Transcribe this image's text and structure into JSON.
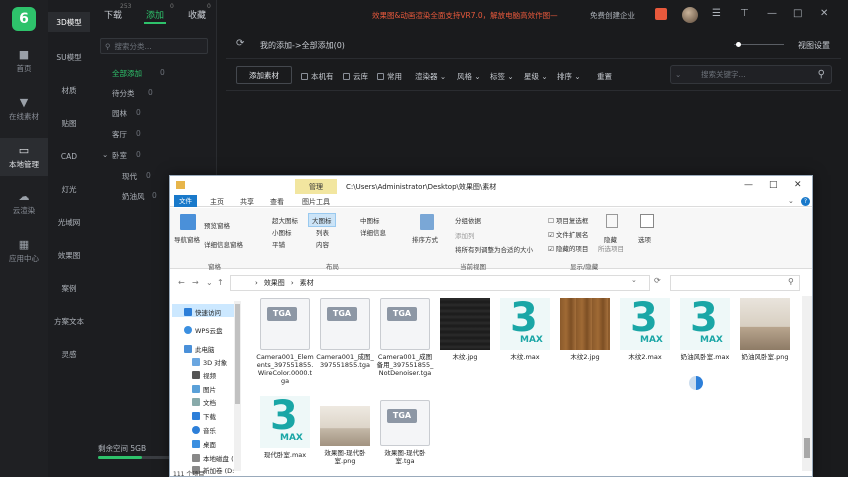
{
  "app": {
    "logo_glyph": "6",
    "rail": [
      {
        "icon": "cube-icon",
        "label": "首页"
      },
      {
        "icon": "download-icon",
        "label": "在线素材"
      },
      {
        "icon": "monitor-icon",
        "label": "本地管理",
        "active": true
      },
      {
        "icon": "cloud-icon",
        "label": "云渲染"
      },
      {
        "icon": "grid-icon",
        "label": "应用中心"
      }
    ],
    "categories": [
      "3D模型",
      "SU模型",
      "材质",
      "贴图",
      "CAD",
      "灯光",
      "光域网",
      "效果图",
      "案例",
      "方案文本",
      "灵感"
    ]
  },
  "tree": {
    "tabs": [
      {
        "label": "下载",
        "count": "253"
      },
      {
        "label": "添加",
        "count": "0"
      },
      {
        "label": "收藏",
        "count": "0"
      }
    ],
    "search_placeholder": "搜索分类...",
    "items": [
      {
        "label": "全部添加",
        "count": "0"
      },
      {
        "label": "待分类",
        "count": "0"
      },
      {
        "label": "园林",
        "count": "0"
      },
      {
        "label": "客厅",
        "count": "0"
      },
      {
        "label": "卧室",
        "count": "0"
      },
      {
        "label": "现代",
        "count": "0"
      },
      {
        "label": "奶油风",
        "count": "0"
      }
    ],
    "space_label": "剩余空间 5GB"
  },
  "header": {
    "banner": "效果图&动画渲染全面支持VR7.0，解放电脑高效作图—",
    "enterprise": "免费创建企业",
    "breadcrumb": "我的添加->全部添加(0)",
    "view_settings": "视图设置"
  },
  "toolbar": {
    "add_button": "添加素材",
    "checks": [
      "本机有",
      "云库",
      "常用"
    ],
    "dropdowns": [
      "渲染器",
      "风格",
      "标签",
      "星级",
      "排序"
    ],
    "reset": "重置",
    "search_placeholder": "搜索关键字..."
  },
  "explorer": {
    "manage_tab": "管理",
    "title_path": "C:\\Users\\Administrator\\Desktop\\效果图\\素材",
    "menu": [
      "文件",
      "主页",
      "共享",
      "查看",
      "图片工具"
    ],
    "ribbon": {
      "nav_pane": "导航窗格",
      "preview_pane": "预览窗格",
      "details_pane": "详细信息窗格",
      "layout_items": [
        "超大图标",
        "大图标",
        "中图标",
        "小图标",
        "列表",
        "详细信息",
        "平铺",
        "内容"
      ],
      "sort_by": "排序方式",
      "group_by": "分组依据",
      "add_column": "添加列",
      "fit_columns": "将所有列调整为合适的大小",
      "checkboxes": [
        "项目复选框",
        "文件扩展名",
        "隐藏的项目"
      ],
      "hide": "隐藏",
      "hide_selected": "所选项目",
      "options": "选项",
      "groups": [
        "窗格",
        "布局",
        "当前视图",
        "显示/隐藏"
      ]
    },
    "address": [
      "效果图",
      "素材"
    ],
    "nav": [
      {
        "label": "快速访问",
        "icon": "star-icon"
      },
      {
        "label": "WPS云盘",
        "icon": "cloud-icon"
      },
      {
        "label": "此电脑",
        "icon": "pc-icon"
      },
      {
        "label": "3D 对象",
        "icon": "cube-icon"
      },
      {
        "label": "视频",
        "icon": "video-icon"
      },
      {
        "label": "图片",
        "icon": "picture-icon"
      },
      {
        "label": "文档",
        "icon": "document-icon"
      },
      {
        "label": "下载",
        "icon": "download-icon"
      },
      {
        "label": "音乐",
        "icon": "music-icon"
      },
      {
        "label": "桌面",
        "icon": "desktop-icon"
      },
      {
        "label": "本地磁盘 (C",
        "icon": "drive-icon"
      },
      {
        "label": "新加卷 (D:",
        "icon": "drive-icon"
      }
    ],
    "status": "111 个项目",
    "files": [
      {
        "name": "Camera001_Elements_397551855.WireColor.0000.tga",
        "kind": "tga"
      },
      {
        "name": "Camera001_成图_397551855.tga",
        "kind": "tga"
      },
      {
        "name": "Camera001_成图备用_397551855_NotDenoiser.tga",
        "kind": "tga"
      },
      {
        "name": "木纹.jpg",
        "kind": "dark"
      },
      {
        "name": "木纹.max",
        "kind": "max"
      },
      {
        "name": "木纹2.jpg",
        "kind": "wood"
      },
      {
        "name": "木纹2.max",
        "kind": "max"
      },
      {
        "name": "奶油风卧室.max",
        "kind": "max"
      },
      {
        "name": "奶油风卧室.png",
        "kind": "room"
      },
      {
        "name": "现代卧室.max",
        "kind": "max"
      },
      {
        "name": "效果图-现代卧室.png",
        "kind": "room2"
      },
      {
        "name": "效果图-现代卧室.tga",
        "kind": "tga"
      }
    ]
  }
}
